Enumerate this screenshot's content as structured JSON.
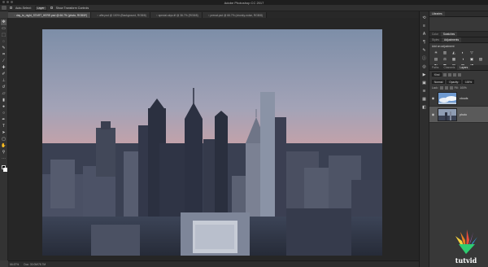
{
  "app": {
    "title": "Adobe Photoshop CC 2017"
  },
  "options_bar": {
    "auto_select_label": "Auto-Select:",
    "auto_select_value": "Layer",
    "transform_label": "Show Transform Controls"
  },
  "tabs": [
    {
      "label": "day_to_night_START_HERE.psd @ 66.7% (photo, RGB/8*)",
      "active": true
    },
    {
      "label": "afte.psd @ 100% (Background, RGB/8)",
      "active": false
    },
    {
      "label": "special-skys.tif @ 36.7% (RGB/8)",
      "active": false
    },
    {
      "label": "prenat.psd @ 66.7% (chunky-noise, RGB/8)",
      "active": false
    }
  ],
  "tools": [
    "move-tool",
    "artboard-tool",
    "marquee-tool",
    "lasso-tool",
    "quick-select-tool",
    "crop-tool",
    "eyedropper-tool",
    "healing-tool",
    "brush-tool",
    "clone-stamp-tool",
    "history-brush-tool",
    "eraser-tool",
    "gradient-tool",
    "blur-tool",
    "dodge-tool",
    "pen-tool",
    "type-tool",
    "path-select-tool",
    "shape-tool",
    "hand-tool",
    "zoom-tool"
  ],
  "status_bar": {
    "zoom": "66.67%",
    "doc": "Doc: 30.0M/78.7M"
  },
  "panels": {
    "top_tabs": [
      "Libraries"
    ],
    "color_tabs": [
      "Color",
      "Swatches"
    ],
    "adjust_tabs": [
      "Styles",
      "Adjustments"
    ],
    "adjust_title": "Add an adjustment",
    "adjust_icons": [
      "☀",
      "▥",
      "◭",
      "◐",
      "▽",
      "",
      "▤",
      "⚖",
      "▦",
      "◑",
      "▣",
      "▧",
      "◧",
      "◩",
      "▨",
      "▩",
      "◨",
      ""
    ],
    "layer_tabs": [
      "Paths",
      "Channels",
      "Layers"
    ],
    "kind_label": "Kind",
    "blend_mode": "Normal",
    "opacity_label": "Opacity:",
    "opacity_value": "100%",
    "lock_label": "Lock:",
    "fill_label": "Fill:",
    "fill_value": "100%",
    "layers": [
      {
        "name": "clouds",
        "selected": false
      },
      {
        "name": "photo",
        "selected": true
      }
    ]
  },
  "watermark": {
    "text": "tutvid"
  }
}
